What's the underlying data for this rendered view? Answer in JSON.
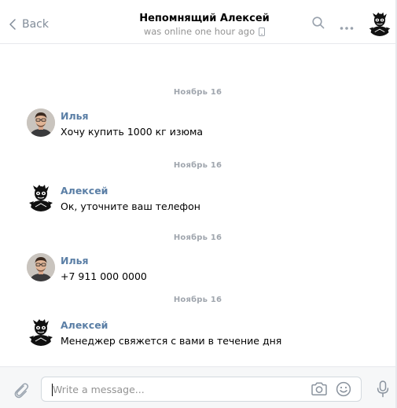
{
  "header": {
    "back_label": "Back",
    "title": "Непомнящий Алексей",
    "status": "was online one hour ago"
  },
  "messages": [
    {
      "date": "Ноябрь 16",
      "author": "Илья",
      "avatar": "ilya",
      "text": "Хочу купить 1000 кг изюма"
    },
    {
      "date": "Ноябрь 16",
      "author": "Алексей",
      "avatar": "alexey",
      "text": "Ок, уточните ваш телефон"
    },
    {
      "date": "Ноябрь 16",
      "author": "Илья",
      "avatar": "ilya",
      "text": "+7 911 000 0000"
    },
    {
      "date": "Ноябрь 16",
      "author": "Алексей",
      "avatar": "alexey",
      "text": "Менеджер свяжется с вами в течение дня"
    }
  ],
  "composer": {
    "placeholder": "Write a message...",
    "value": ""
  },
  "colors": {
    "author_link": "#5b7fa6",
    "muted": "#818c99",
    "date": "#a0a6ae",
    "composer_bg": "#f6f7f8",
    "border": "#e7e8ec"
  },
  "icons": [
    "chevron-left-icon",
    "search-icon",
    "more-icon",
    "phone-icon",
    "paperclip-icon",
    "camera-icon",
    "smile-icon",
    "microphone-icon"
  ]
}
